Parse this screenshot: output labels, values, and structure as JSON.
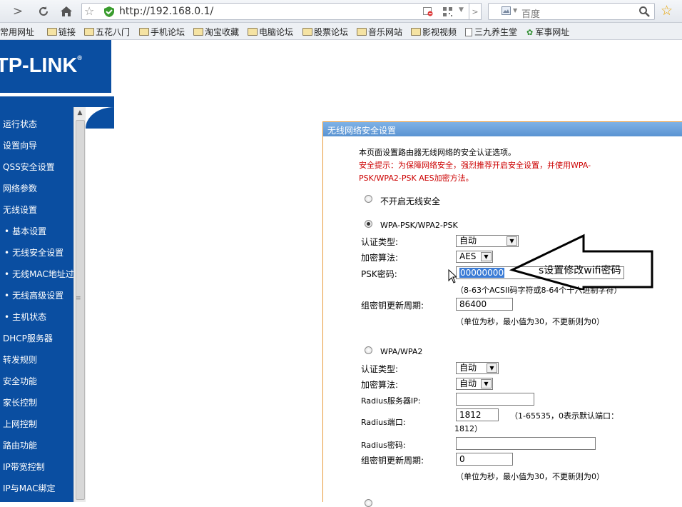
{
  "browser": {
    "url": "http://192.168.0.1/",
    "search_placeholder": "百度"
  },
  "bookmarks": [
    {
      "label": "常用网址",
      "type": "folder"
    },
    {
      "label": "链接",
      "type": "folder"
    },
    {
      "label": "五花八门",
      "type": "folder"
    },
    {
      "label": "手机论坛",
      "type": "folder"
    },
    {
      "label": "淘宝收藏",
      "type": "folder"
    },
    {
      "label": "电脑论坛",
      "type": "folder"
    },
    {
      "label": "股票论坛",
      "type": "folder"
    },
    {
      "label": "音乐网站",
      "type": "folder"
    },
    {
      "label": "影视视频",
      "type": "folder"
    },
    {
      "label": "三九养生堂",
      "type": "page"
    },
    {
      "label": "军事网址",
      "type": "site"
    }
  ],
  "brand": {
    "name": "TP-LINK",
    "mark": "®"
  },
  "sidebar": {
    "items": [
      {
        "label": "运行状态",
        "sub": false
      },
      {
        "label": "设置向导",
        "sub": false
      },
      {
        "label": "QSS安全设置",
        "sub": false
      },
      {
        "label": "网络参数",
        "sub": false
      },
      {
        "label": "无线设置",
        "sub": false
      },
      {
        "label": "基本设置",
        "sub": true
      },
      {
        "label": "无线安全设置",
        "sub": true
      },
      {
        "label": "无线MAC地址过滤",
        "sub": true
      },
      {
        "label": "无线高级设置",
        "sub": true
      },
      {
        "label": "主机状态",
        "sub": true
      },
      {
        "label": "DHCP服务器",
        "sub": false
      },
      {
        "label": "转发规则",
        "sub": false
      },
      {
        "label": "安全功能",
        "sub": false
      },
      {
        "label": "家长控制",
        "sub": false
      },
      {
        "label": "上网控制",
        "sub": false
      },
      {
        "label": "路由功能",
        "sub": false
      },
      {
        "label": "IP带宽控制",
        "sub": false
      },
      {
        "label": "IP与MAC绑定",
        "sub": false
      }
    ]
  },
  "panel": {
    "title": "无线网络安全设置",
    "intro": "本页面设置路由器无线网络的安全认证选项。",
    "warning_line1": "安全提示：为保障网络安全，强烈推荐开启安全设置，并使用WPA-",
    "warning_line2": "PSK/WPA2-PSK AES加密方法。",
    "option_none": "不开启无线安全",
    "wpa_psk": {
      "title": "WPA-PSK/WPA2-PSK",
      "auth_label": "认证类型:",
      "auth_value": "自动",
      "enc_label": "加密算法:",
      "enc_value": "AES",
      "psk_label": "PSK密码:",
      "psk_value": "00000000",
      "psk_hint": "（8-63个ACSII码字符或8-64个十六进制字符）",
      "renew_label": "组密钥更新周期:",
      "renew_value": "86400",
      "renew_hint": "（单位为秒，最小值为30，不更新则为0）"
    },
    "wpa": {
      "title": "WPA/WPA2",
      "auth_label": "认证类型:",
      "auth_value": "自动",
      "enc_label": "加密算法:",
      "enc_value": "自动",
      "radius_ip_label": "Radius服务器IP:",
      "radius_ip_value": "",
      "radius_port_label": "Radius端口:",
      "radius_port_value": "1812",
      "radius_port_hint": "（1-65535，0表示默认端口：",
      "radius_port_hint2": "1812）",
      "radius_pwd_label": "Radius密码:",
      "radius_pwd_value": "",
      "renew_label": "组密钥更新周期:",
      "renew_value": "0",
      "renew_hint": "（单位为秒，最小值为30，不更新则为0）"
    }
  },
  "annotation": {
    "text": "s设置修改wifi密码"
  }
}
